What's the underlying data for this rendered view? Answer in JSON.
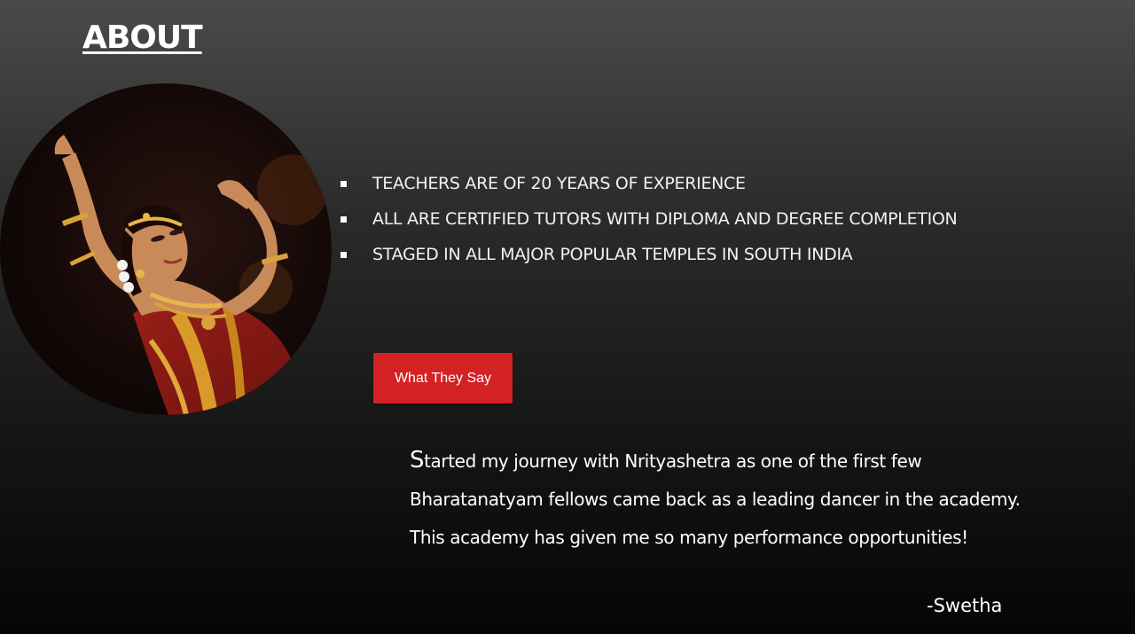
{
  "header": {
    "title": "ABOUT"
  },
  "about": {
    "bullets": [
      "TEACHERS ARE OF 20 YEARS OF EXPERIENCE",
      "ALL ARE CERTIFIED TUTORS WITH DIPLOMA AND DEGREE COMPLETION",
      "STAGED IN ALL MAJOR POPULAR TEMPLES IN  SOUTH INDIA"
    ],
    "photo_icon": "dancer-photo"
  },
  "testimonial": {
    "button_label": "What They Say",
    "quote_first_letter": "S",
    "quote_line_1_rest": "tarted my journey with Nrityashetra as one of the first few",
    "quote_line_2": "Bharatanatyam fellows came back as a leading dancer in the academy.",
    "quote_line_3": "This academy has given me so many performance opportunities!",
    "author": "-Swetha"
  },
  "colors": {
    "accent_button": "#d42124",
    "text": "#ffffff",
    "background_top": "#4a4a4a",
    "background_bottom": "#050505"
  }
}
